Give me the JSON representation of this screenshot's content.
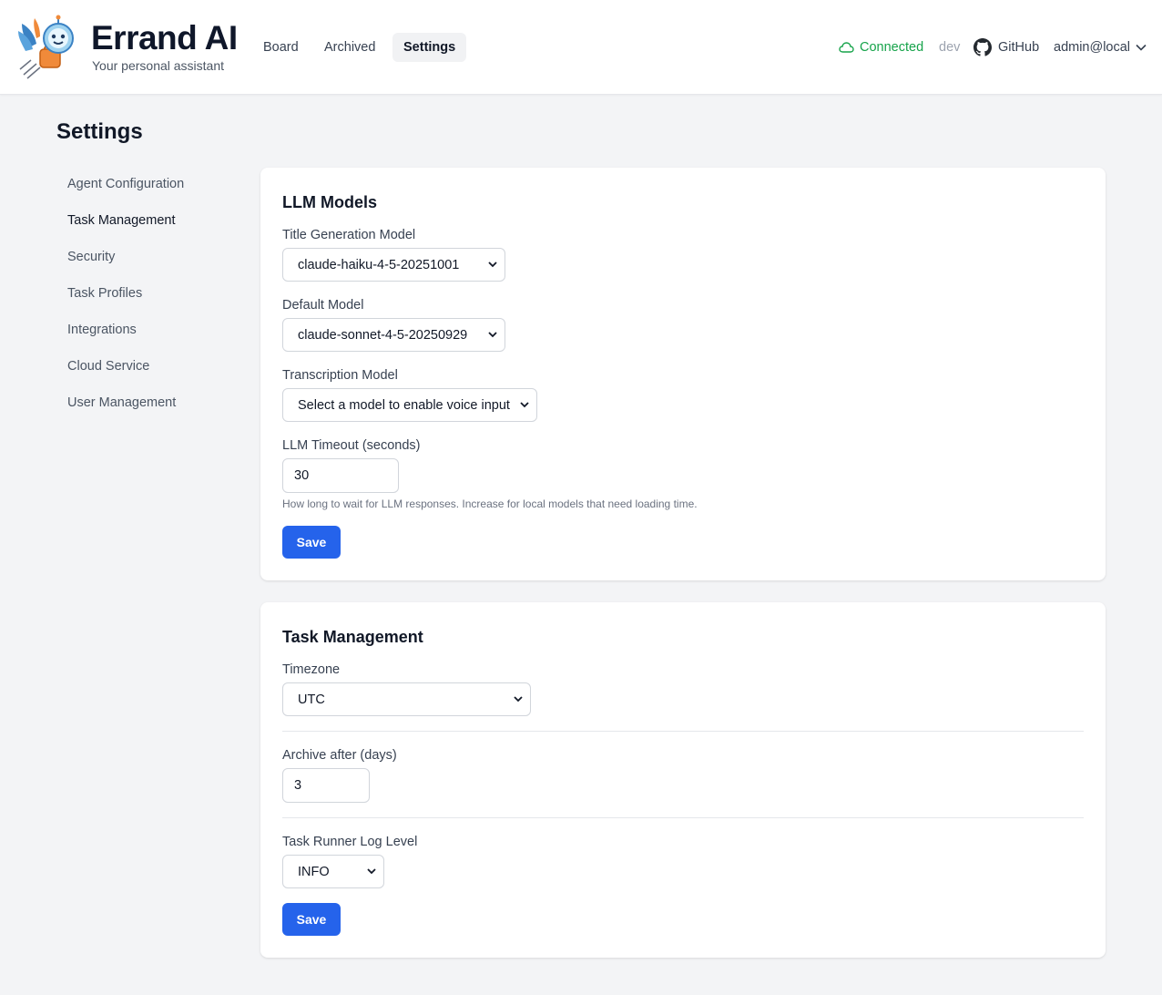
{
  "brand": {
    "title": "Errand AI",
    "subtitle": "Your personal assistant"
  },
  "nav": {
    "board": "Board",
    "archived": "Archived",
    "settings": "Settings"
  },
  "header": {
    "status": "Connected",
    "env": "dev",
    "github": "GitHub",
    "user": "admin@local"
  },
  "page": {
    "title": "Settings"
  },
  "sidebar": {
    "items": [
      {
        "label": "Agent Configuration"
      },
      {
        "label": "Task Management"
      },
      {
        "label": "Security"
      },
      {
        "label": "Task Profiles"
      },
      {
        "label": "Integrations"
      },
      {
        "label": "Cloud Service"
      },
      {
        "label": "User Management"
      }
    ]
  },
  "llm": {
    "title": "LLM Models",
    "title_model_label": "Title Generation Model",
    "title_model_value": "claude-haiku-4-5-20251001",
    "default_model_label": "Default Model",
    "default_model_value": "claude-sonnet-4-5-20250929",
    "transcription_label": "Transcription Model",
    "transcription_value": "Select a model to enable voice input",
    "timeout_label": "LLM Timeout (seconds)",
    "timeout_value": "30",
    "timeout_help": "How long to wait for LLM responses. Increase for local models that need loading time.",
    "save": "Save"
  },
  "tasks": {
    "title": "Task Management",
    "timezone_label": "Timezone",
    "timezone_value": "UTC",
    "archive_label": "Archive after (days)",
    "archive_value": "3",
    "log_label": "Task Runner Log Level",
    "log_value": "INFO",
    "save": "Save"
  },
  "colors": {
    "accent": "#2563eb",
    "connected": "#16a34a",
    "background": "#f3f4f6"
  }
}
